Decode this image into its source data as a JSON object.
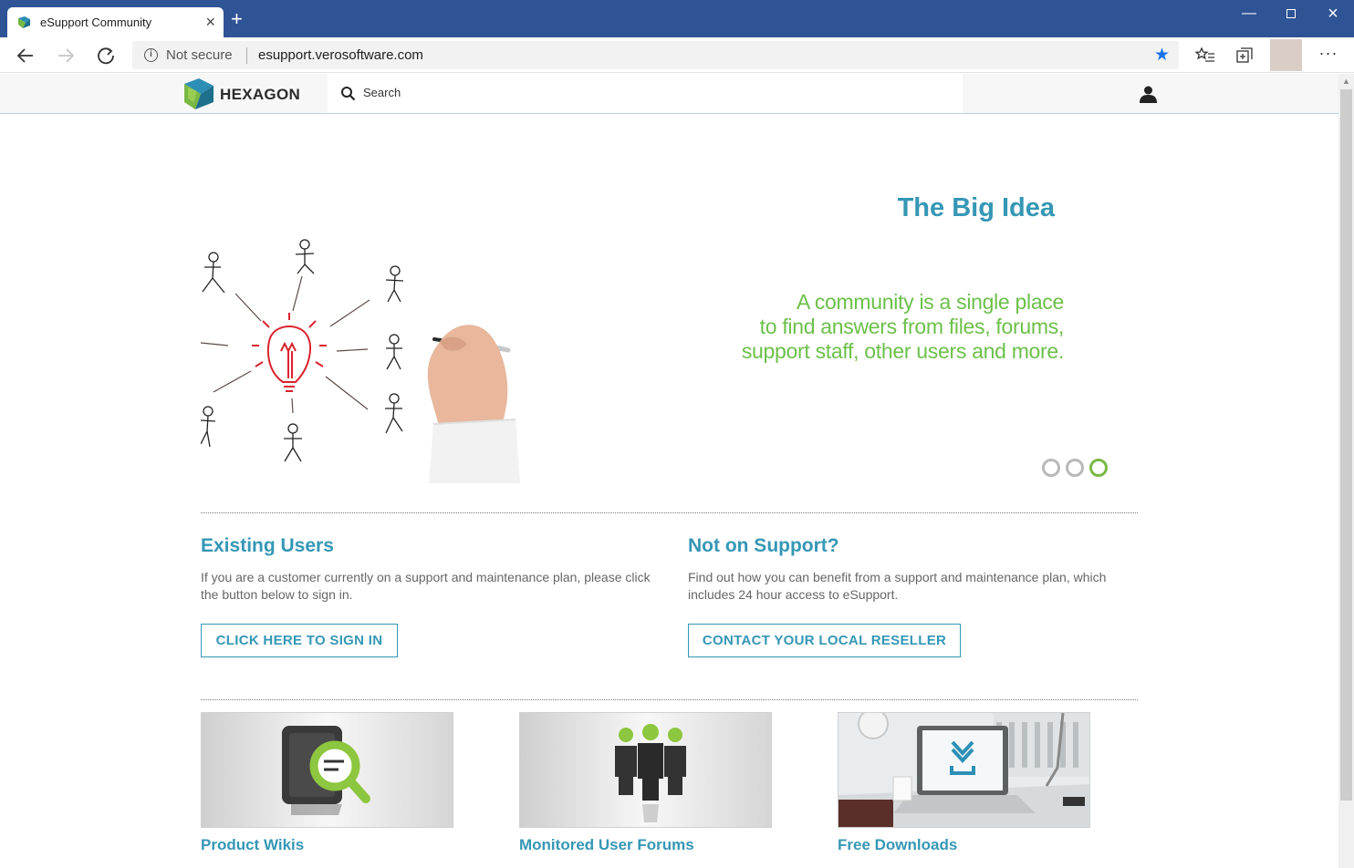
{
  "browser": {
    "tab_title": "eSupport Community",
    "new_tab_icon": "plus-icon",
    "security_label": "Not secure",
    "url": "esupport.verosoftware.com"
  },
  "site": {
    "logo_text": "HEXAGON",
    "search_label": "Search"
  },
  "hero": {
    "title": "The Big Idea",
    "text": "A community is a single place\nto find answers from files, forums,\nsupport staff, other users and more.",
    "slides": 3,
    "active_slide": 3,
    "accent_color": "#3597b5",
    "text_color": "#6cc04a"
  },
  "existing_users": {
    "heading": "Existing Users",
    "text": "If you are a customer currently on a support and maintenance plan, please click the button below to sign in.",
    "button": "CLICK HERE TO SIGN IN"
  },
  "not_on_support": {
    "heading": "Not on Support?",
    "text": "Find out how you can benefit from a support and maintenance plan, which includes 24 hour access to eSupport.",
    "button": "CONTACT YOUR LOCAL RESELLER"
  },
  "cards": [
    {
      "title": "Product Wikis"
    },
    {
      "title": "Monitored User Forums"
    },
    {
      "title": "Free Downloads"
    }
  ]
}
